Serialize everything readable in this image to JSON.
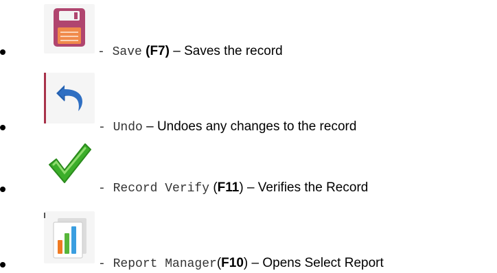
{
  "items": [
    {
      "icon": "floppy-disk-save-icon",
      "command": "Save",
      "before_key": " (",
      "key": "F7",
      "after_key": ")",
      "description": " – Saves the record"
    },
    {
      "icon": "undo-arrow-icon",
      "command": "Undo",
      "description": " – Undoes any changes to the record"
    },
    {
      "icon": "green-checkmark-icon",
      "command": "Record Verify",
      "before_key": " (",
      "key": "F11",
      "after_key": ")",
      "description": " – Verifies the Record"
    },
    {
      "icon": "bar-chart-report-icon",
      "command": "Report Manager",
      "before_key": "(",
      "key": "F10",
      "after_key": ")",
      "description": " – Opens Select Report"
    }
  ],
  "separator": "- ",
  "colors": {
    "save_icon_body": "#b0456f",
    "save_icon_label": "#f08a4b",
    "undo_arrow": "#2f6fc2",
    "check_green": "#3cae2a",
    "chart_orange": "#f07a22",
    "chart_green": "#57b63a",
    "chart_blue": "#3a9ee0"
  }
}
